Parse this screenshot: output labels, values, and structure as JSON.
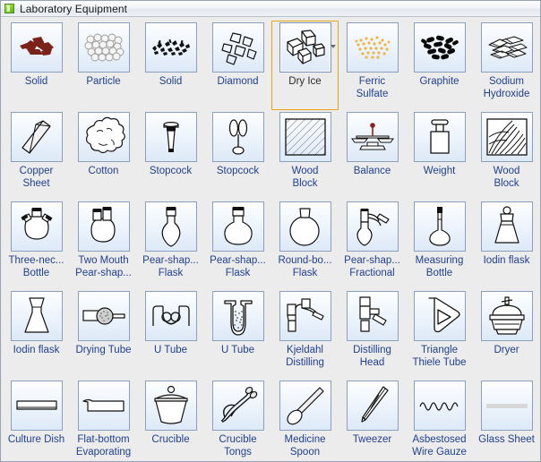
{
  "window": {
    "title": "Laboratory Equipment",
    "title_icon": "green-square-icon",
    "colors": {
      "background": "#ececec",
      "tile_border": "#8ba0bd",
      "tile_fill_top": "#fdfeff",
      "tile_fill_bottom": "#dde9f7",
      "label_text": "#1f3f8f",
      "selection_fill": "#ffd75f",
      "selection_border": "#e8a317",
      "titlebar_text": "#1a1a1a"
    }
  },
  "palette": {
    "selected_item": "Dry Ice",
    "columns": 8,
    "rows": 5,
    "items": [
      {
        "label": "Solid",
        "icon": "solid-chunks-icon",
        "selected": false
      },
      {
        "label": "Particle",
        "icon": "particle-circles-icon",
        "selected": false
      },
      {
        "label": "Solid",
        "icon": "solid-granules-icon",
        "selected": false
      },
      {
        "label": "Diamond",
        "icon": "diamond-crystals-icon",
        "selected": false
      },
      {
        "label": "Dry Ice",
        "icon": "dry-ice-cubes-icon",
        "selected": true
      },
      {
        "label": "Ferric\nSulfate",
        "icon": "ferric-sulfate-icon",
        "selected": false
      },
      {
        "label": "Graphite",
        "icon": "graphite-icon",
        "selected": false
      },
      {
        "label": "Sodium\nHydroxide",
        "icon": "sodium-hydroxide-icon",
        "selected": false
      },
      {
        "label": "Copper\nSheet",
        "icon": "copper-sheet-icon",
        "selected": false
      },
      {
        "label": "Cotton",
        "icon": "cotton-icon",
        "selected": false
      },
      {
        "label": "Stopcock",
        "icon": "stopcock-plug-icon",
        "selected": false
      },
      {
        "label": "Stopcock",
        "icon": "stopcock-valve-icon",
        "selected": false
      },
      {
        "label": "Wood\nBlock",
        "icon": "wood-block-hatched-icon",
        "selected": false
      },
      {
        "label": "Balance",
        "icon": "balance-scale-icon",
        "selected": false
      },
      {
        "label": "Weight",
        "icon": "weight-icon",
        "selected": false
      },
      {
        "label": "Wood\nBlock",
        "icon": "wood-block-grain-icon",
        "selected": false
      },
      {
        "label": "Three-nec...\nBottle",
        "icon": "three-neck-bottle-icon",
        "selected": false
      },
      {
        "label": "Two Mouth\nPear-shap...",
        "icon": "two-mouth-flask-icon",
        "selected": false
      },
      {
        "label": "Pear-shap...\nFlask",
        "icon": "pear-shaped-flask-icon",
        "selected": false
      },
      {
        "label": "Pear-shap...\nFlask",
        "icon": "pear-flask-round-icon",
        "selected": false
      },
      {
        "label": "Round-bo...\nFlask",
        "icon": "round-bottom-flask-icon",
        "selected": false
      },
      {
        "label": "Pear-shap...\nFractional",
        "icon": "fractional-flask-icon",
        "selected": false
      },
      {
        "label": "Measuring\nBottle",
        "icon": "measuring-bottle-icon",
        "selected": false
      },
      {
        "label": "Iodin flask",
        "icon": "iodin-flask-stopper-icon",
        "selected": false
      },
      {
        "label": "Iodin flask",
        "icon": "iodin-flask-icon",
        "selected": false
      },
      {
        "label": "Drying Tube",
        "icon": "drying-tube-icon",
        "selected": false
      },
      {
        "label": "U Tube",
        "icon": "u-tube-bulbs-icon",
        "selected": false
      },
      {
        "label": "U Tube",
        "icon": "u-tube-filled-icon",
        "selected": false
      },
      {
        "label": "Kjeldahl\nDistilling",
        "icon": "kjeldahl-distilling-icon",
        "selected": false
      },
      {
        "label": "Distilling\nHead",
        "icon": "distilling-head-icon",
        "selected": false
      },
      {
        "label": "Triangle\nThiele Tube",
        "icon": "thiele-tube-icon",
        "selected": false
      },
      {
        "label": "Dryer",
        "icon": "dryer-desiccator-icon",
        "selected": false
      },
      {
        "label": "Culture Dish",
        "icon": "culture-dish-icon",
        "selected": false
      },
      {
        "label": "Flat-bottom\nEvaporating",
        "icon": "evaporating-dish-icon",
        "selected": false
      },
      {
        "label": "Crucible",
        "icon": "crucible-icon",
        "selected": false
      },
      {
        "label": "Crucible\nTongs",
        "icon": "crucible-tongs-icon",
        "selected": false
      },
      {
        "label": "Medicine\nSpoon",
        "icon": "medicine-spoon-icon",
        "selected": false
      },
      {
        "label": "Tweezer",
        "icon": "tweezer-icon",
        "selected": false
      },
      {
        "label": "Asbestosed\nWire Gauze",
        "icon": "wire-gauze-icon",
        "selected": false
      },
      {
        "label": "Glass Sheet",
        "icon": "glass-sheet-icon",
        "selected": false
      }
    ]
  }
}
